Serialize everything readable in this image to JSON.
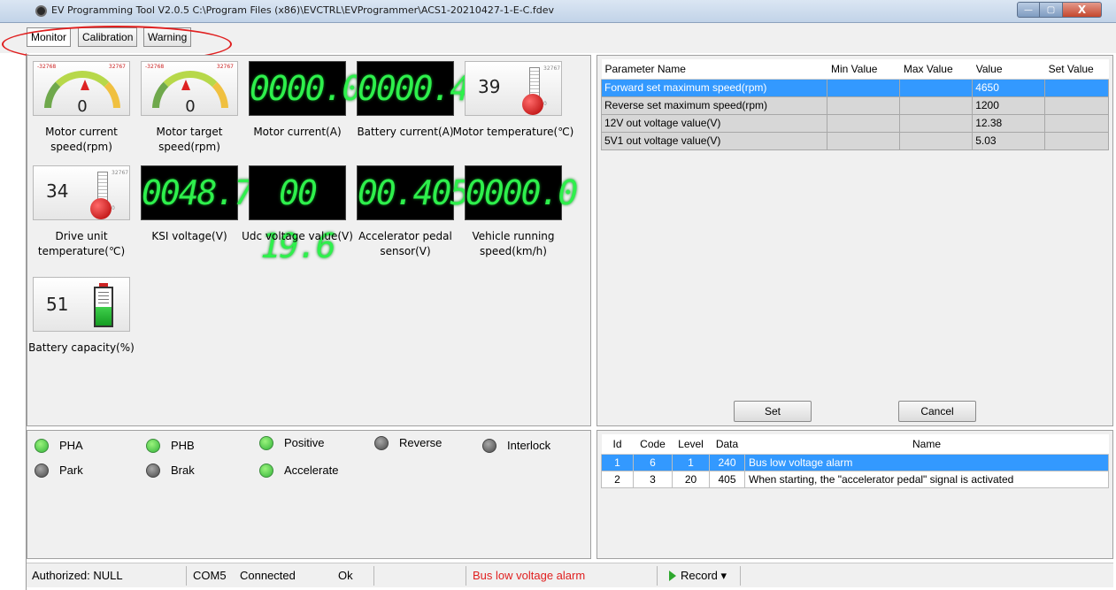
{
  "window": {
    "title": "EV Programming Tool V2.0.5 C:\\Program Files (x86)\\EVCTRL\\EVProgrammer\\ACS1-20210427-1-E-C.fdev",
    "controls": {
      "minimize": "—",
      "maximize": "▢",
      "close": "X"
    }
  },
  "tabs": [
    "Monitor",
    "Calibration",
    "Warning"
  ],
  "gauges": {
    "motor_current_speed": {
      "value": "0",
      "label": "Motor current speed(rpm)",
      "scale_min": "-32768",
      "scale_max": "32767"
    },
    "motor_target_speed": {
      "value": "0",
      "label": "Motor target speed(rpm)",
      "scale_min": "-32768",
      "scale_max": "32767"
    },
    "motor_current": {
      "value": "0000.0",
      "label": "Motor current(A)"
    },
    "battery_current": {
      "value": "0000.4",
      "label": "Battery current(A)"
    },
    "motor_temperature": {
      "value": "39",
      "label": "Motor temperature(℃)",
      "scale_max": "32767",
      "scale_min": "0"
    },
    "drive_unit_temperature": {
      "value": "34",
      "label": "Drive unit temperature(℃)",
      "scale_max": "32767",
      "scale_min": "0"
    },
    "ksi_voltage": {
      "value": "0048.7",
      "label": "KSI voltage(V)"
    },
    "udc_voltage": {
      "value": "00 19.6",
      "label": "Udc voltage value(V)"
    },
    "accelerator_pedal": {
      "value": "00.405",
      "label": "Accelerator pedal sensor(V)"
    },
    "vehicle_speed": {
      "value": "0000.0",
      "label": "Vehicle running speed(km/h)"
    },
    "battery_capacity": {
      "value": "51",
      "label": "Battery capacity(%)",
      "level_percent": 51
    }
  },
  "parameters": {
    "columns": [
      "Parameter Name",
      "Min Value",
      "Max Value",
      "Value",
      "Set Value"
    ],
    "rows": [
      {
        "name": "Forward set maximum speed(rpm)",
        "min": "",
        "max": "",
        "value": "4650",
        "set": ""
      },
      {
        "name": "Reverse set maximum speed(rpm)",
        "min": "",
        "max": "",
        "value": "1200",
        "set": ""
      },
      {
        "name": "12V out voltage value(V)",
        "min": "",
        "max": "",
        "value": "12.38",
        "set": ""
      },
      {
        "name": "5V1 out voltage value(V)",
        "min": "",
        "max": "",
        "value": "5.03",
        "set": ""
      }
    ],
    "set_button": "Set",
    "cancel_button": "Cancel"
  },
  "status_lights": [
    {
      "label": "PHA",
      "state": "on"
    },
    {
      "label": "PHB",
      "state": "on"
    },
    {
      "label": "Positive",
      "state": "on"
    },
    {
      "label": "Reverse",
      "state": "off"
    },
    {
      "label": "Interlock",
      "state": "off"
    },
    {
      "label": "Park",
      "state": "off"
    },
    {
      "label": "Brak",
      "state": "off"
    },
    {
      "label": "Accelerate",
      "state": "on"
    }
  ],
  "alarms": {
    "columns": [
      "Id",
      "Code",
      "Level",
      "Data",
      "Name"
    ],
    "rows": [
      {
        "id": "1",
        "code": "6",
        "level": "1",
        "data": "240",
        "name": "Bus low voltage alarm"
      },
      {
        "id": "2",
        "code": "3",
        "level": "20",
        "data": "405",
        "name": "When starting, the \"accelerator pedal\" signal is activated"
      }
    ]
  },
  "statusbar": {
    "authorized": "Authorized: NULL",
    "port": "COM5",
    "connection": "Connected",
    "state": "Ok",
    "alarm": "Bus low voltage alarm",
    "record": "Record ▾"
  },
  "colors": {
    "selection": "#3399ff",
    "lcd_digits": "#2ef04c",
    "alarm_text": "#e02020",
    "highlight_ellipse": "#e02020"
  }
}
